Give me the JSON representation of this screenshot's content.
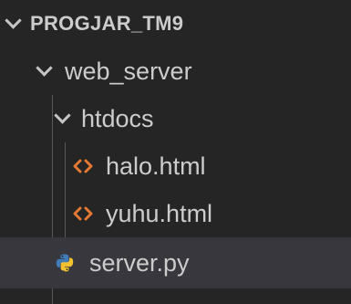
{
  "explorer": {
    "root": {
      "label": "PROGJAR_TM9",
      "icon": "chevron-down-icon"
    },
    "items": [
      {
        "label": "web_server",
        "type": "folder",
        "icon": "chevron-down-icon"
      },
      {
        "label": "htdocs",
        "type": "folder",
        "icon": "chevron-down-icon"
      },
      {
        "label": "halo.html",
        "type": "file",
        "icon": "html-file-icon"
      },
      {
        "label": "yuhu.html",
        "type": "file",
        "icon": "html-file-icon"
      },
      {
        "label": "server.py",
        "type": "file",
        "icon": "python-file-icon"
      }
    ]
  },
  "colors": {
    "background": "#252526",
    "selected_row": "#37373d",
    "text": "#cccccc",
    "html_icon": "#e37933",
    "python_icon_blue": "#3f7cb8",
    "python_icon_yellow": "#f2c231"
  }
}
